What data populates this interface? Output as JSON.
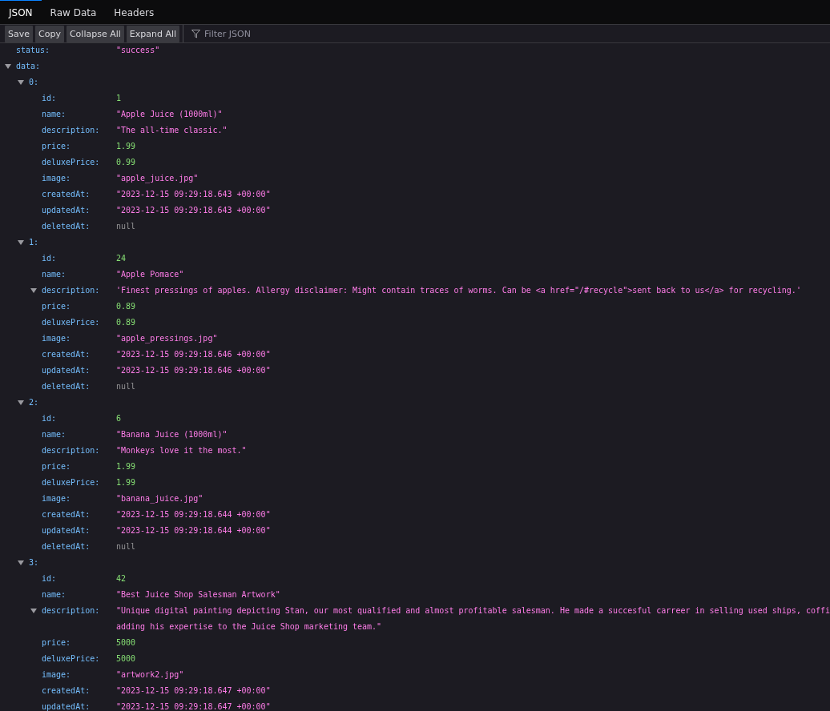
{
  "tabs": [
    {
      "label": "JSON",
      "selected": true
    },
    {
      "label": "Raw Data",
      "selected": false
    },
    {
      "label": "Headers",
      "selected": false
    }
  ],
  "toolbar": {
    "buttons": [
      "Save",
      "Copy",
      "Collapse All",
      "Expand All"
    ],
    "filter": {
      "placeholder": "Filter JSON"
    }
  },
  "tree": [
    {
      "key": "status:",
      "kind": "string",
      "value": "\"success\""
    },
    {
      "key": "data:",
      "expanded": true,
      "children": [
        {
          "key": "0:",
          "expanded": true,
          "children": [
            {
              "key": "id:",
              "kind": "number",
              "value": "1"
            },
            {
              "key": "name:",
              "kind": "string",
              "value": "\"Apple Juice (1000ml)\""
            },
            {
              "key": "description:",
              "kind": "string",
              "value": "\"The all-time classic.\""
            },
            {
              "key": "price:",
              "kind": "number",
              "value": "1.99"
            },
            {
              "key": "deluxePrice:",
              "kind": "number",
              "value": "0.99"
            },
            {
              "key": "image:",
              "kind": "string",
              "value": "\"apple_juice.jpg\""
            },
            {
              "key": "createdAt:",
              "kind": "string",
              "value": "\"2023-12-15 09:29:18.643 +00:00\""
            },
            {
              "key": "updatedAt:",
              "kind": "string",
              "value": "\"2023-12-15 09:29:18.643 +00:00\""
            },
            {
              "key": "deletedAt:",
              "kind": "null",
              "value": "null"
            }
          ]
        },
        {
          "key": "1:",
          "expanded": true,
          "children": [
            {
              "key": "id:",
              "kind": "number",
              "value": "24"
            },
            {
              "key": "name:",
              "kind": "string",
              "value": "\"Apple Pomace\""
            },
            {
              "key": "description:",
              "kind": "string",
              "expanded": true,
              "value": "'Finest pressings of apples. Allergy disclaimer: Might contain traces of worms. Can be <a href=\"/#recycle\">sent back to us</a> for recycling.'"
            },
            {
              "key": "price:",
              "kind": "number",
              "value": "0.89"
            },
            {
              "key": "deluxePrice:",
              "kind": "number",
              "value": "0.89"
            },
            {
              "key": "image:",
              "kind": "string",
              "value": "\"apple_pressings.jpg\""
            },
            {
              "key": "createdAt:",
              "kind": "string",
              "value": "\"2023-12-15 09:29:18.646 +00:00\""
            },
            {
              "key": "updatedAt:",
              "kind": "string",
              "value": "\"2023-12-15 09:29:18.646 +00:00\""
            },
            {
              "key": "deletedAt:",
              "kind": "null",
              "value": "null"
            }
          ]
        },
        {
          "key": "2:",
          "expanded": true,
          "children": [
            {
              "key": "id:",
              "kind": "number",
              "value": "6"
            },
            {
              "key": "name:",
              "kind": "string",
              "value": "\"Banana Juice (1000ml)\""
            },
            {
              "key": "description:",
              "kind": "string",
              "value": "\"Monkeys love it the most.\""
            },
            {
              "key": "price:",
              "kind": "number",
              "value": "1.99"
            },
            {
              "key": "deluxePrice:",
              "kind": "number",
              "value": "1.99"
            },
            {
              "key": "image:",
              "kind": "string",
              "value": "\"banana_juice.jpg\""
            },
            {
              "key": "createdAt:",
              "kind": "string",
              "value": "\"2023-12-15 09:29:18.644 +00:00\""
            },
            {
              "key": "updatedAt:",
              "kind": "string",
              "value": "\"2023-12-15 09:29:18.644 +00:00\""
            },
            {
              "key": "deletedAt:",
              "kind": "null",
              "value": "null"
            }
          ]
        },
        {
          "key": "3:",
          "expanded": true,
          "children": [
            {
              "key": "id:",
              "kind": "number",
              "value": "42"
            },
            {
              "key": "name:",
              "kind": "string",
              "value": "\"Best Juice Shop Salesman Artwork\""
            },
            {
              "key": "description:",
              "kind": "string",
              "expanded": true,
              "lines": [
                "\"Unique digital painting depicting Stan, our most qualified and almost profitable salesman. He made a succesful carreer in selling used ships, coffi",
                "adding his expertise to the Juice Shop marketing team.\""
              ]
            },
            {
              "key": "price:",
              "kind": "number",
              "value": "5000"
            },
            {
              "key": "deluxePrice:",
              "kind": "number",
              "value": "5000"
            },
            {
              "key": "image:",
              "kind": "string",
              "value": "\"artwork2.jpg\""
            },
            {
              "key": "createdAt:",
              "kind": "string",
              "value": "\"2023-12-15 09:29:18.647 +00:00\""
            },
            {
              "key": "updatedAt:",
              "kind": "string",
              "value": "\"2023-12-15 09:29:18.647 +00:00\""
            }
          ]
        }
      ]
    }
  ]
}
